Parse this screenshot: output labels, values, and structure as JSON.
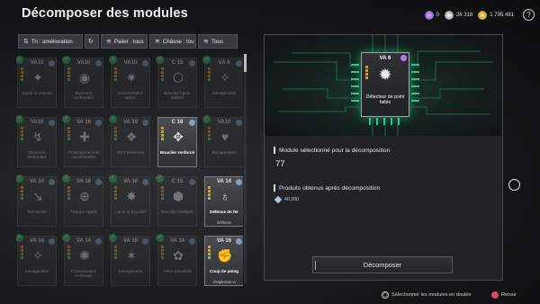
{
  "header": {
    "title": "Décomposer des modules",
    "currencies": [
      {
        "icon": "purple-gem-icon",
        "value": "0"
      },
      {
        "icon": "silver-coin-icon",
        "value": "26 318"
      },
      {
        "icon": "gold-coin-icon",
        "value": "1 795 481"
      }
    ],
    "help_label": "?"
  },
  "filters": {
    "sort_label": "Tri : amélioration",
    "tier_label": "Palier : tous",
    "chassis_label": "Châsse : tou",
    "all_label": "Tous"
  },
  "grid": {
    "cards": [
      {
        "row": 0,
        "col": 0,
        "version": "VA10",
        "name": "Santé et chemin",
        "sub": "",
        "emblem": "✦",
        "selected": true,
        "dim": true
      },
      {
        "row": 0,
        "col": 1,
        "version": "VA10",
        "name": "Rumeurs renforcées",
        "sub": "",
        "emblem": "◉",
        "selected": true,
        "dim": true
      },
      {
        "row": 0,
        "col": 2,
        "version": "VA10",
        "name": "Concentration active",
        "sub": "",
        "emblem": "✷",
        "selected": true,
        "dim": true
      },
      {
        "row": 0,
        "col": 3,
        "version": "C 15",
        "name": "Bouclier haute fiabilité",
        "sub": "",
        "emblem": "⬡",
        "selected": true,
        "dim": true
      },
      {
        "row": 0,
        "col": 4,
        "version": "VA 4",
        "name": "Introspection",
        "sub": "",
        "emblem": "✧",
        "selected": true,
        "dim": true
      },
      {
        "row": 1,
        "col": 0,
        "version": "VA10",
        "name": "Rumeurs renforcées",
        "sub": "",
        "emblem": "↯",
        "selected": true,
        "dim": true
      },
      {
        "row": 1,
        "col": 1,
        "version": "VA 16",
        "name": "Prolongement de concentration",
        "sub": "",
        "emblem": "✚",
        "selected": true,
        "dim": true
      },
      {
        "row": 1,
        "col": 2,
        "version": "VA 18",
        "name": "DGT renforcés",
        "sub": "",
        "emblem": "❖",
        "selected": true,
        "dim": true
      },
      {
        "row": 1,
        "col": 3,
        "version": "C 18",
        "name": "Bouclier renforcé",
        "sub": "",
        "emblem": "✥",
        "selected": false,
        "dim": false
      },
      {
        "row": 1,
        "col": 4,
        "version": "VA10",
        "name": "Récupération",
        "sub": "",
        "emblem": "♥",
        "selected": true,
        "dim": true
      },
      {
        "row": 2,
        "col": 0,
        "version": "VA 14",
        "name": "Technicien",
        "sub": "",
        "emblem": "↘",
        "selected": true,
        "dim": true
      },
      {
        "row": 2,
        "col": 1,
        "version": "VA 16",
        "name": "Attaque rapide",
        "sub": "",
        "emblem": "⊕",
        "selected": true,
        "dim": true
      },
      {
        "row": 2,
        "col": 2,
        "version": "VA 16",
        "name": "Lame et bouclier",
        "sub": "",
        "emblem": "✸",
        "selected": true,
        "dim": true
      },
      {
        "row": 2,
        "col": 3,
        "version": "C 15",
        "name": "Bouclier résistant",
        "sub": "",
        "emblem": "⬢",
        "selected": true,
        "dim": true
      },
      {
        "row": 2,
        "col": 4,
        "version": "VA 14",
        "name": "Défense de fer",
        "sub": "Défense",
        "emblem": "♁",
        "selected": false,
        "dim": false
      },
      {
        "row": 3,
        "col": 0,
        "version": "VA 14",
        "name": "Introspection",
        "sub": "",
        "emblem": "✧",
        "selected": true,
        "dim": true
      },
      {
        "row": 3,
        "col": 1,
        "version": "VA 14",
        "name": "Concentration renforcée",
        "sub": "",
        "emblem": "✺",
        "selected": true,
        "dim": true
      },
      {
        "row": 3,
        "col": 2,
        "version": "VA 18",
        "name": "Introspection",
        "sub": "",
        "emblem": "✶",
        "selected": true,
        "dim": true
      },
      {
        "row": 3,
        "col": 3,
        "version": "VA 14",
        "name": "Arbre ancestral",
        "sub": "",
        "emblem": "✿",
        "selected": true,
        "dim": true
      },
      {
        "row": 3,
        "col": 4,
        "version": "VA 16",
        "name": "Coup de poing",
        "sub": "d'explosion vi",
        "emblem": "✊",
        "selected": false,
        "dim": false
      }
    ]
  },
  "panel": {
    "chip": {
      "version": "VA 6",
      "name": "Détecteur de point faible",
      "emblem": "✹"
    },
    "selected_label": "Module sélectionné pour la décomposition",
    "selected_count": "77",
    "results_label": "Produits obtenus après décomposition",
    "result_value": "40,200",
    "result_icon": "crystal-icon",
    "decompose_label": "Décomposer"
  },
  "footer": {
    "select_hint": "Sélectionner les modules en double",
    "back_hint": "Retour"
  },
  "colors": {
    "accent_green": "#3fae6a",
    "glow_green": "#28e696",
    "back_red": "#d24a6a"
  }
}
